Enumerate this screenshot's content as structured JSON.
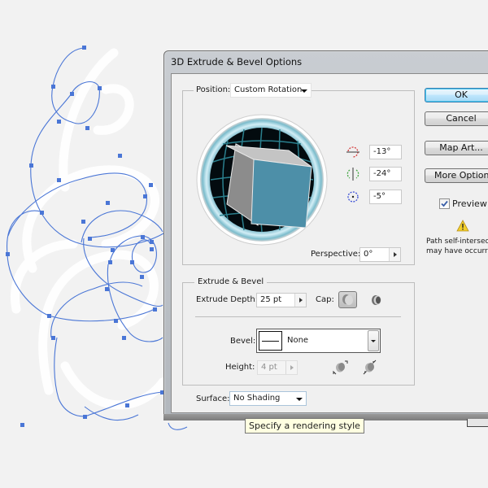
{
  "dialog": {
    "title": "3D Extrude & Bevel Options"
  },
  "position": {
    "label": "Position:",
    "preset": "Custom Rotation",
    "rotation_x": "-13°",
    "rotation_y": "-24°",
    "rotation_z": "-5°",
    "perspective_label": "Perspective:",
    "perspective_value": "0°"
  },
  "extrude": {
    "legend": "Extrude & Bevel",
    "depth_label": "Extrude Depth:",
    "depth_value": "25 pt",
    "cap_label": "Cap:",
    "bevel_label": "Bevel:",
    "bevel_value": "None",
    "height_label": "Height:",
    "height_value": "4 pt"
  },
  "surface": {
    "label": "Surface:",
    "value": "No Shading"
  },
  "buttons": {
    "ok": "OK",
    "cancel": "Cancel",
    "map_art": "Map Art...",
    "more_options": "More Options"
  },
  "preview": {
    "label": "Preview",
    "checked": true
  },
  "warning": {
    "line1": "Path self-intersection",
    "line2": "may have occurred"
  },
  "tooltip": {
    "text": "Specify a rendering style"
  },
  "colors": {
    "path_stroke": "#4a76d6",
    "cube_front": "#4d8fa8",
    "cube_side": "#8c8c8c",
    "cube_top": "#c4c4c4",
    "ok_accent": "#3c7fb1"
  }
}
